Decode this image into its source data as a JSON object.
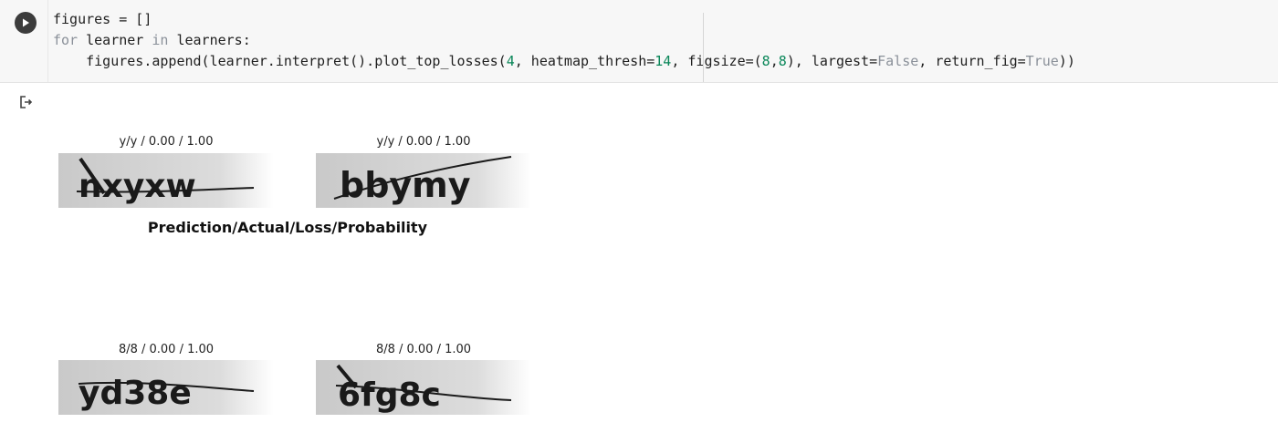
{
  "cell": {
    "run_icon": "play-icon",
    "code_lines": [
      {
        "parts": [
          {
            "t": "figures = []",
            "c": ""
          }
        ]
      },
      {
        "parts": [
          {
            "t": "for",
            "c": "kw"
          },
          {
            "t": " learner ",
            "c": ""
          },
          {
            "t": "in",
            "c": "kw"
          },
          {
            "t": " learners:",
            "c": ""
          }
        ]
      },
      {
        "parts": [
          {
            "t": "    figures.append(learner.interpret().plot_top_losses(",
            "c": ""
          },
          {
            "t": "4",
            "c": "num"
          },
          {
            "t": ", heatmap_thresh=",
            "c": ""
          },
          {
            "t": "14",
            "c": "num"
          },
          {
            "t": ", figsize=(",
            "c": ""
          },
          {
            "t": "8",
            "c": "num"
          },
          {
            "t": ",",
            "c": ""
          },
          {
            "t": "8",
            "c": "num"
          },
          {
            "t": "), largest=",
            "c": ""
          },
          {
            "t": "False",
            "c": "lit"
          },
          {
            "t": ", return_fig=",
            "c": ""
          },
          {
            "t": "True",
            "c": "lit"
          },
          {
            "t": "))",
            "c": ""
          }
        ]
      }
    ]
  },
  "output": {
    "icon": "output-redirect-icon",
    "suptitle": "Prediction/Actual/Loss/Probability",
    "figures": [
      {
        "title": "y/y / 0.00 / 1.00",
        "captcha_text": "nxyxw"
      },
      {
        "title": "y/y / 0.00 / 1.00",
        "captcha_text": "bbymy"
      },
      {
        "title": "8/8 / 0.00 / 1.00",
        "captcha_text": "yd38e"
      },
      {
        "title": "8/8 / 0.00 / 1.00",
        "captcha_text": "6fg8c"
      }
    ]
  }
}
